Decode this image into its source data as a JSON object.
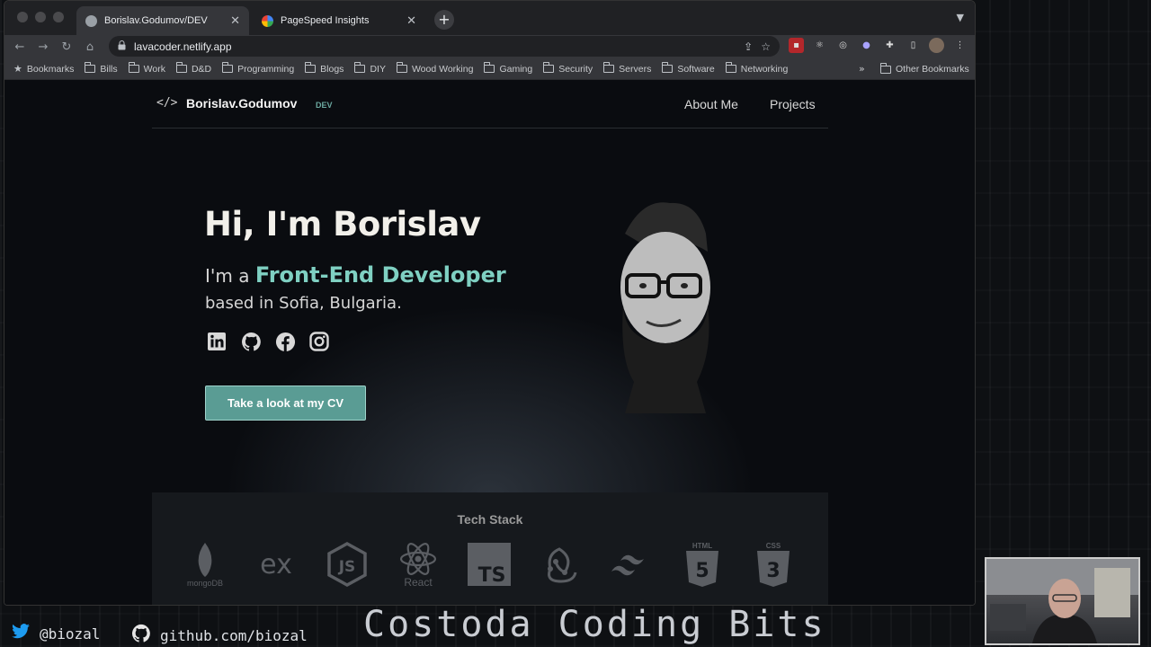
{
  "browser": {
    "tabs": [
      {
        "title": "Borislav.Godumov/DEV",
        "active": true
      },
      {
        "title": "PageSpeed Insights",
        "active": false
      }
    ],
    "new_tab_label": "+",
    "url": "lavacoder.netlify.app",
    "bookmarks": [
      "Bookmarks",
      "Bills",
      "Work",
      "D&D",
      "Programming",
      "Blogs",
      "DIY",
      "Wood Working",
      "Gaming",
      "Security",
      "Servers",
      "Software",
      "Networking"
    ],
    "bookmarks_more": "»",
    "other_bookmarks": "Other Bookmarks"
  },
  "site": {
    "logo_code": "</>",
    "logo_name": "Borislav.Godumov",
    "logo_suffix": "DEV",
    "nav": [
      "About Me",
      "Projects"
    ],
    "hero": {
      "title": "Hi, I'm Borislav",
      "intro": "I'm a",
      "role": "Front-End Developer",
      "location": "based in Sofia, Bulgaria.",
      "cta": "Take a look at my CV"
    },
    "socials": [
      "linkedin-icon",
      "github-icon",
      "facebook-icon",
      "instagram-icon"
    ],
    "tech_stack_title": "Tech Stack",
    "tech_stack": [
      "mongoDB",
      "express",
      "nodejs",
      "React",
      "TypeScript",
      "Redux",
      "Tailwind",
      "HTML5",
      "CSS3"
    ]
  },
  "overlay": {
    "channel_title": "Costoda Coding Bits",
    "twitter": "@biozal",
    "github": "github.com/biozal"
  },
  "colors": {
    "accent": "#7fd0c2",
    "button": "#5a9c94",
    "background": "#0a0c10"
  }
}
